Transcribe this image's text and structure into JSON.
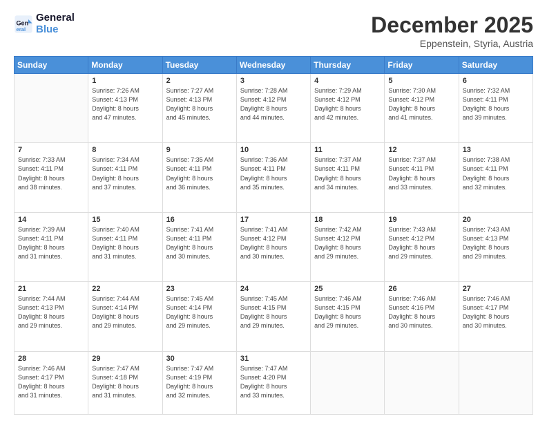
{
  "header": {
    "logo_line1": "General",
    "logo_line2": "Blue",
    "month_title": "December 2025",
    "location": "Eppenstein, Styria, Austria"
  },
  "days_of_week": [
    "Sunday",
    "Monday",
    "Tuesday",
    "Wednesday",
    "Thursday",
    "Friday",
    "Saturday"
  ],
  "weeks": [
    [
      {
        "day": "",
        "info": ""
      },
      {
        "day": "1",
        "info": "Sunrise: 7:26 AM\nSunset: 4:13 PM\nDaylight: 8 hours\nand 47 minutes."
      },
      {
        "day": "2",
        "info": "Sunrise: 7:27 AM\nSunset: 4:13 PM\nDaylight: 8 hours\nand 45 minutes."
      },
      {
        "day": "3",
        "info": "Sunrise: 7:28 AM\nSunset: 4:12 PM\nDaylight: 8 hours\nand 44 minutes."
      },
      {
        "day": "4",
        "info": "Sunrise: 7:29 AM\nSunset: 4:12 PM\nDaylight: 8 hours\nand 42 minutes."
      },
      {
        "day": "5",
        "info": "Sunrise: 7:30 AM\nSunset: 4:12 PM\nDaylight: 8 hours\nand 41 minutes."
      },
      {
        "day": "6",
        "info": "Sunrise: 7:32 AM\nSunset: 4:11 PM\nDaylight: 8 hours\nand 39 minutes."
      }
    ],
    [
      {
        "day": "7",
        "info": "Sunrise: 7:33 AM\nSunset: 4:11 PM\nDaylight: 8 hours\nand 38 minutes."
      },
      {
        "day": "8",
        "info": "Sunrise: 7:34 AM\nSunset: 4:11 PM\nDaylight: 8 hours\nand 37 minutes."
      },
      {
        "day": "9",
        "info": "Sunrise: 7:35 AM\nSunset: 4:11 PM\nDaylight: 8 hours\nand 36 minutes."
      },
      {
        "day": "10",
        "info": "Sunrise: 7:36 AM\nSunset: 4:11 PM\nDaylight: 8 hours\nand 35 minutes."
      },
      {
        "day": "11",
        "info": "Sunrise: 7:37 AM\nSunset: 4:11 PM\nDaylight: 8 hours\nand 34 minutes."
      },
      {
        "day": "12",
        "info": "Sunrise: 7:37 AM\nSunset: 4:11 PM\nDaylight: 8 hours\nand 33 minutes."
      },
      {
        "day": "13",
        "info": "Sunrise: 7:38 AM\nSunset: 4:11 PM\nDaylight: 8 hours\nand 32 minutes."
      }
    ],
    [
      {
        "day": "14",
        "info": "Sunrise: 7:39 AM\nSunset: 4:11 PM\nDaylight: 8 hours\nand 31 minutes."
      },
      {
        "day": "15",
        "info": "Sunrise: 7:40 AM\nSunset: 4:11 PM\nDaylight: 8 hours\nand 31 minutes."
      },
      {
        "day": "16",
        "info": "Sunrise: 7:41 AM\nSunset: 4:11 PM\nDaylight: 8 hours\nand 30 minutes."
      },
      {
        "day": "17",
        "info": "Sunrise: 7:41 AM\nSunset: 4:12 PM\nDaylight: 8 hours\nand 30 minutes."
      },
      {
        "day": "18",
        "info": "Sunrise: 7:42 AM\nSunset: 4:12 PM\nDaylight: 8 hours\nand 29 minutes."
      },
      {
        "day": "19",
        "info": "Sunrise: 7:43 AM\nSunset: 4:12 PM\nDaylight: 8 hours\nand 29 minutes."
      },
      {
        "day": "20",
        "info": "Sunrise: 7:43 AM\nSunset: 4:13 PM\nDaylight: 8 hours\nand 29 minutes."
      }
    ],
    [
      {
        "day": "21",
        "info": "Sunrise: 7:44 AM\nSunset: 4:13 PM\nDaylight: 8 hours\nand 29 minutes."
      },
      {
        "day": "22",
        "info": "Sunrise: 7:44 AM\nSunset: 4:14 PM\nDaylight: 8 hours\nand 29 minutes."
      },
      {
        "day": "23",
        "info": "Sunrise: 7:45 AM\nSunset: 4:14 PM\nDaylight: 8 hours\nand 29 minutes."
      },
      {
        "day": "24",
        "info": "Sunrise: 7:45 AM\nSunset: 4:15 PM\nDaylight: 8 hours\nand 29 minutes."
      },
      {
        "day": "25",
        "info": "Sunrise: 7:46 AM\nSunset: 4:15 PM\nDaylight: 8 hours\nand 29 minutes."
      },
      {
        "day": "26",
        "info": "Sunrise: 7:46 AM\nSunset: 4:16 PM\nDaylight: 8 hours\nand 30 minutes."
      },
      {
        "day": "27",
        "info": "Sunrise: 7:46 AM\nSunset: 4:17 PM\nDaylight: 8 hours\nand 30 minutes."
      }
    ],
    [
      {
        "day": "28",
        "info": "Sunrise: 7:46 AM\nSunset: 4:17 PM\nDaylight: 8 hours\nand 31 minutes."
      },
      {
        "day": "29",
        "info": "Sunrise: 7:47 AM\nSunset: 4:18 PM\nDaylight: 8 hours\nand 31 minutes."
      },
      {
        "day": "30",
        "info": "Sunrise: 7:47 AM\nSunset: 4:19 PM\nDaylight: 8 hours\nand 32 minutes."
      },
      {
        "day": "31",
        "info": "Sunrise: 7:47 AM\nSunset: 4:20 PM\nDaylight: 8 hours\nand 33 minutes."
      },
      {
        "day": "",
        "info": ""
      },
      {
        "day": "",
        "info": ""
      },
      {
        "day": "",
        "info": ""
      }
    ]
  ]
}
